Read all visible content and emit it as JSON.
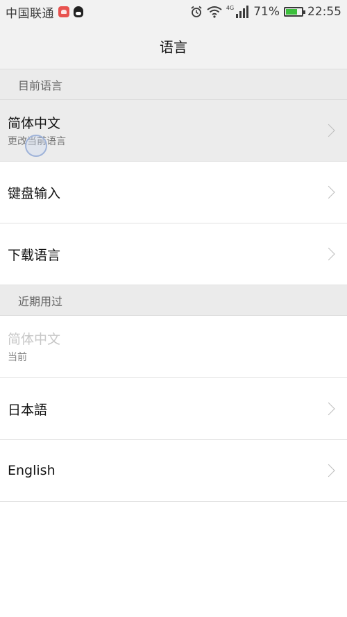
{
  "status_bar": {
    "carrier": "中国联通",
    "network_type": "4G",
    "battery_percent": "71%",
    "battery_level": 0.71,
    "time": "22:55",
    "icons": [
      "huawei-app-icon",
      "qq-icon",
      "alarm-icon",
      "wifi-icon",
      "signal-icon",
      "battery-charging-icon"
    ]
  },
  "header": {
    "title": "语言"
  },
  "current_section": {
    "header": "目前语言",
    "items": [
      {
        "label": "简体中文",
        "sub": "更改当前语言"
      },
      {
        "label": "键盘输入"
      },
      {
        "label": "下载语言"
      }
    ]
  },
  "recent_section": {
    "header": "近期用过",
    "items": [
      {
        "label": "简体中文",
        "sub": "当前"
      },
      {
        "label": "日本語"
      },
      {
        "label": "English"
      }
    ]
  },
  "colors": {
    "bar_background": "#f2f2f2",
    "section_background": "#ebebeb",
    "battery_fill": "#3cbf3c"
  }
}
